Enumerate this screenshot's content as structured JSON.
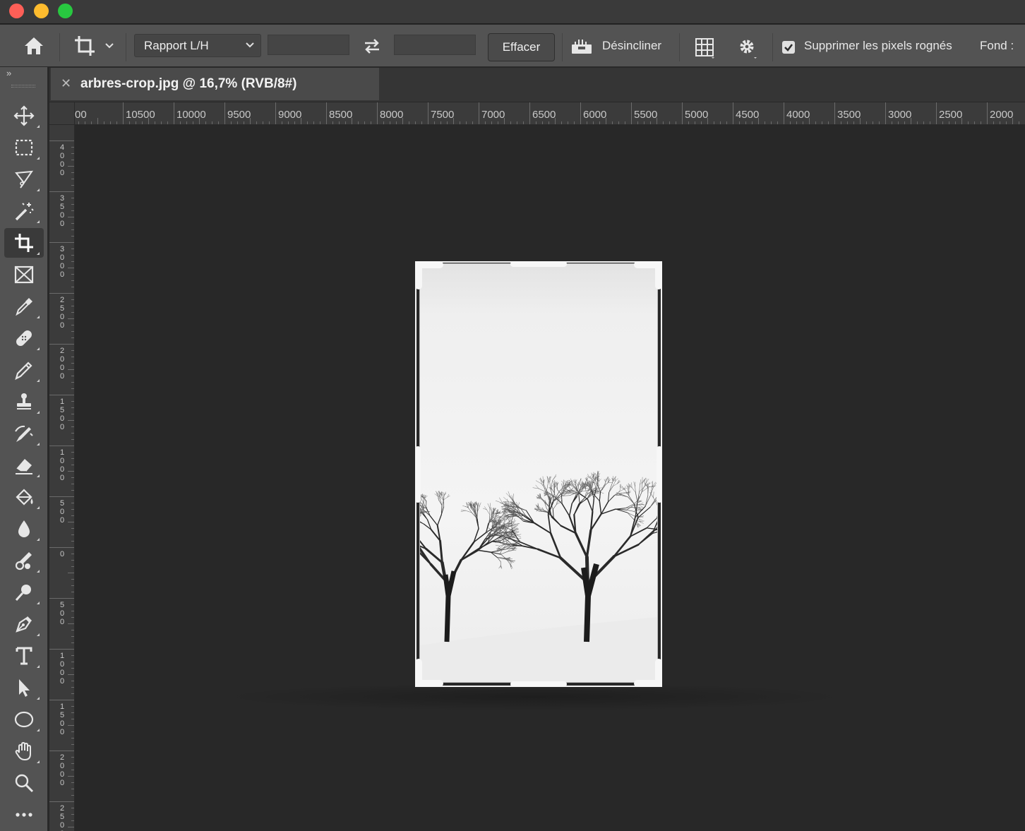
{
  "window": {
    "traffic_lights": [
      "close",
      "minimize",
      "zoom"
    ]
  },
  "options_bar": {
    "ratio_label": "Rapport L/H",
    "width_value": "",
    "height_value": "",
    "clear_label": "Effacer",
    "straighten_label": "Désincliner",
    "delete_pixels_label": "Supprimer les pixels rognés",
    "delete_pixels_checked": true,
    "fill_label": "Fond :"
  },
  "document": {
    "tab_title": "arbres-crop.jpg @ 16,7% (RVB/8#)"
  },
  "toolbar": {
    "active_tool": "crop-tool",
    "tools": [
      "move-tool",
      "marquee-tool",
      "lasso-tool",
      "magic-wand-tool",
      "crop-tool",
      "frame-tool",
      "eyedropper-tool",
      "healing-brush-tool",
      "brush-tool",
      "stamp-tool",
      "history-brush-tool",
      "eraser-tool",
      "paint-bucket-tool",
      "blur-tool",
      "smudge-tool",
      "dodge-tool",
      "pen-tool",
      "type-tool",
      "path-selection-tool",
      "ellipse-tool",
      "hand-tool",
      "zoom-tool",
      "more-tools"
    ]
  },
  "rulers": {
    "horizontal": [
      "00",
      "10500",
      "10000",
      "9500",
      "9000",
      "8500",
      "8000",
      "7500",
      "7000",
      "6500",
      "6000",
      "5500",
      "5000",
      "4500",
      "4000",
      "3500",
      "3000",
      "2500",
      "2000"
    ],
    "vertical": [
      "4000",
      "3500",
      "3000",
      "2500",
      "2000",
      "1500",
      "1000",
      "500",
      "0",
      "500",
      "1000",
      "1500",
      "2000",
      "2500"
    ]
  },
  "colors": {
    "app_bg": "#282828",
    "panel": "#535353",
    "accent_light": "#f4f4f4"
  }
}
